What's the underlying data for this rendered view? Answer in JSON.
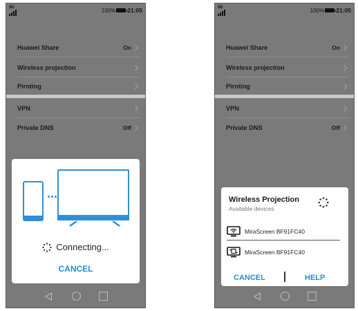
{
  "status_bar": {
    "network": "5G",
    "battery": "100%",
    "time": "21:05"
  },
  "settings": {
    "items": [
      {
        "label": "Huawei Share",
        "value": "On"
      },
      {
        "label": "Wireless projection",
        "value": ""
      },
      {
        "label": "Pirnting",
        "value": ""
      },
      {
        "label": "VPN",
        "value": ""
      },
      {
        "label": "Private DNS",
        "value": "Off"
      }
    ]
  },
  "connecting_dialog": {
    "status": "Connecting...",
    "cancel": "CANCEL"
  },
  "projection_dialog": {
    "title": "Wireless Projection",
    "subtitle": "Available devices",
    "devices": [
      "MiraScreen BF91FC40",
      "MiraScreen BF91FC40"
    ],
    "cancel": "CANCEL",
    "help": "HELP"
  },
  "colors": {
    "accent": "#1f8fd6",
    "illustration": "#2e8fd6",
    "background": "#7a7a7a"
  },
  "icons": [
    "signal-icon",
    "battery-icon",
    "chevron-right-icon",
    "back-icon",
    "home-icon",
    "recent-apps-icon",
    "spinner-icon",
    "display-device-icon",
    "screen-mirror-icon"
  ]
}
